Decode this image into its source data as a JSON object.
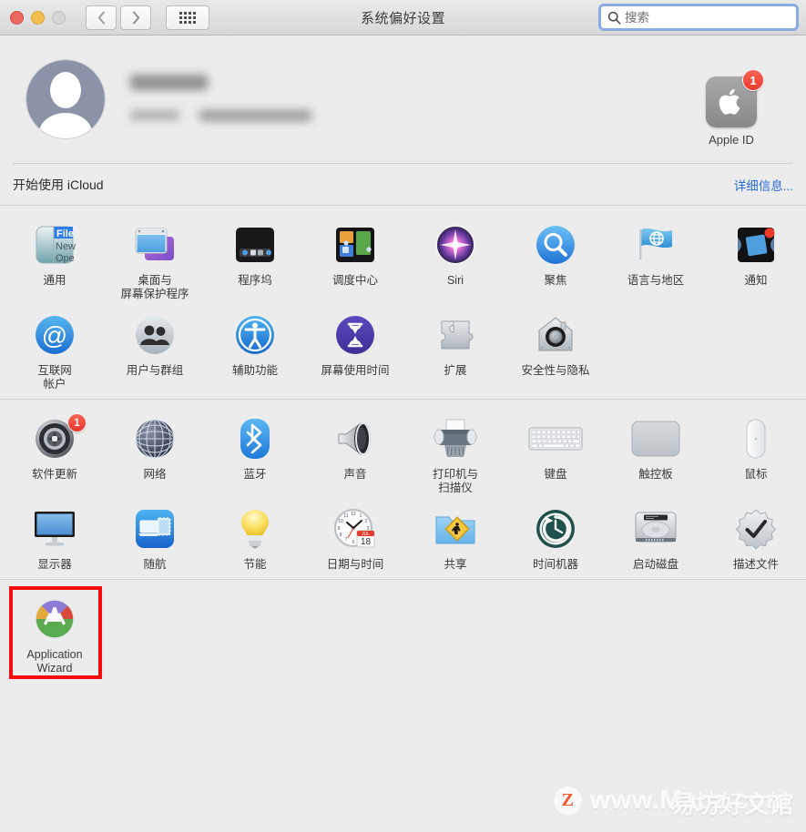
{
  "window": {
    "title": "系统偏好设置",
    "traffic_lights": [
      "close",
      "minimize",
      "zoom"
    ],
    "nav": {
      "back": "back-chevron",
      "forward": "forward-chevron",
      "grid": "show-all-grid"
    }
  },
  "search": {
    "placeholder": "搜索",
    "value": "",
    "icon": "search-icon",
    "focused": true
  },
  "account": {
    "avatar": "default-user-avatar",
    "name_redacted": true,
    "email_redacted": true,
    "apple_id": {
      "label": "Apple ID",
      "icon": "apple-logo-icon",
      "badge": "1"
    }
  },
  "icloud": {
    "text": "开始使用 iCloud",
    "link": "详细信息..."
  },
  "sections": [
    {
      "name": "personal",
      "items": [
        {
          "label": "通用",
          "icon": "general-icon"
        },
        {
          "label": "桌面与\n屏幕保护程序",
          "icon": "desktop-screensaver-icon"
        },
        {
          "label": "程序坞",
          "icon": "dock-icon"
        },
        {
          "label": "调度中心",
          "icon": "mission-control-icon"
        },
        {
          "label": "Siri",
          "icon": "siri-icon"
        },
        {
          "label": "聚焦",
          "icon": "spotlight-icon"
        },
        {
          "label": "语言与地区",
          "icon": "language-region-icon"
        },
        {
          "label": "通知",
          "icon": "notifications-icon"
        },
        {
          "label": "互联网\n帐户",
          "icon": "internet-accounts-icon"
        },
        {
          "label": "用户与群组",
          "icon": "users-groups-icon"
        },
        {
          "label": "辅助功能",
          "icon": "accessibility-icon"
        },
        {
          "label": "屏幕使用时间",
          "icon": "screen-time-icon"
        },
        {
          "label": "扩展",
          "icon": "extensions-puzzle-icon"
        },
        {
          "label": "安全性与隐私",
          "icon": "security-privacy-icon"
        }
      ]
    },
    {
      "name": "hardware",
      "items": [
        {
          "label": "软件更新",
          "icon": "software-update-icon",
          "badge": "1"
        },
        {
          "label": "网络",
          "icon": "network-globe-icon"
        },
        {
          "label": "蓝牙",
          "icon": "bluetooth-icon"
        },
        {
          "label": "声音",
          "icon": "sound-speaker-icon"
        },
        {
          "label": "打印机与\n扫描仪",
          "icon": "printers-scanners-icon"
        },
        {
          "label": "键盘",
          "icon": "keyboard-icon"
        },
        {
          "label": "触控板",
          "icon": "trackpad-icon"
        },
        {
          "label": "鼠标",
          "icon": "mouse-icon"
        },
        {
          "label": "显示器",
          "icon": "displays-icon",
          "highlighted": true
        },
        {
          "label": "随航",
          "icon": "sidecar-icon"
        },
        {
          "label": "节能",
          "icon": "energy-saver-bulb-icon"
        },
        {
          "label": "日期与时间",
          "icon": "date-time-clock-icon",
          "calendar_month": "JUL",
          "calendar_day": "18"
        },
        {
          "label": "共享",
          "icon": "sharing-folder-icon"
        },
        {
          "label": "时间机器",
          "icon": "time-machine-icon"
        },
        {
          "label": "启动磁盘",
          "icon": "startup-disk-icon"
        },
        {
          "label": "描述文件",
          "icon": "profiles-check-icon"
        }
      ]
    },
    {
      "name": "other",
      "items": [
        {
          "label": "Application\nWizard",
          "icon": "application-wizard-icon"
        }
      ]
    }
  ],
  "watermark": {
    "logo": "Z",
    "url": "www.Macz.com",
    "cn": "易坊好文馆"
  },
  "colors": {
    "window_bg": "#ececec",
    "accent_blue": "#2a6ddb",
    "badge_red": "#e8392c",
    "highlight_red": "#f40c0c",
    "focus_ring": "#8aabe0"
  }
}
